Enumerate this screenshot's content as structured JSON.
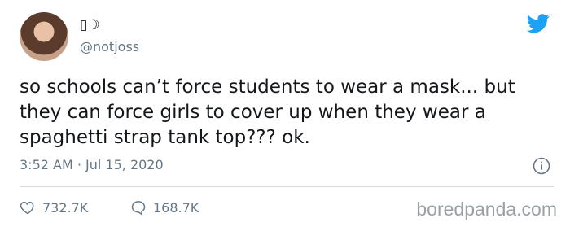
{
  "user": {
    "display_name": "▯☽",
    "username": "@notjoss"
  },
  "tweet": {
    "text": "so schools can’t force students to wear a mask... but they can force girls to cover up when they wear a spaghetti strap tank top??? ok.",
    "meta": "3:52 AM · Jul 15, 2020"
  },
  "stats": {
    "likes": "732.7K",
    "replies": "168.7K"
  },
  "watermark": "boredpanda.com",
  "icons": {
    "brand": "twitter-bird-icon",
    "info": "info-icon",
    "like": "heart-icon",
    "reply": "comment-bubble-icon"
  },
  "colors": {
    "brand": "#1da1f2",
    "muted": "#657786"
  }
}
